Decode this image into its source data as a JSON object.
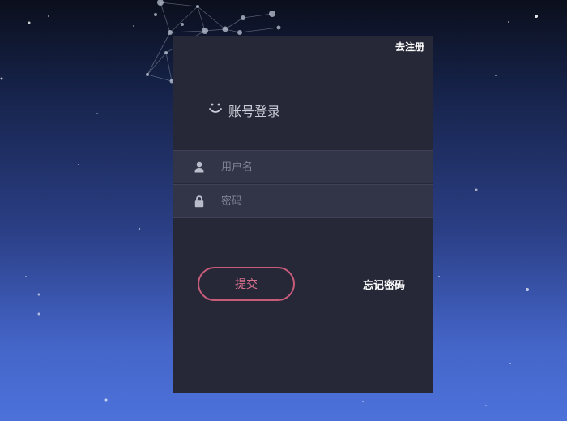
{
  "header": {
    "register_link": "去注册"
  },
  "login": {
    "title": "账号登录",
    "username_placeholder": "用户名",
    "password_placeholder": "密码",
    "submit_label": "提交",
    "forgot_label": "忘记密码"
  },
  "icons": {
    "title": "smile-icon",
    "username": "user-icon",
    "password": "lock-icon"
  },
  "colors": {
    "panel": "#262837",
    "field": "#323547",
    "submit_border": "#c75c7a",
    "submit_text": "#d8708e"
  }
}
